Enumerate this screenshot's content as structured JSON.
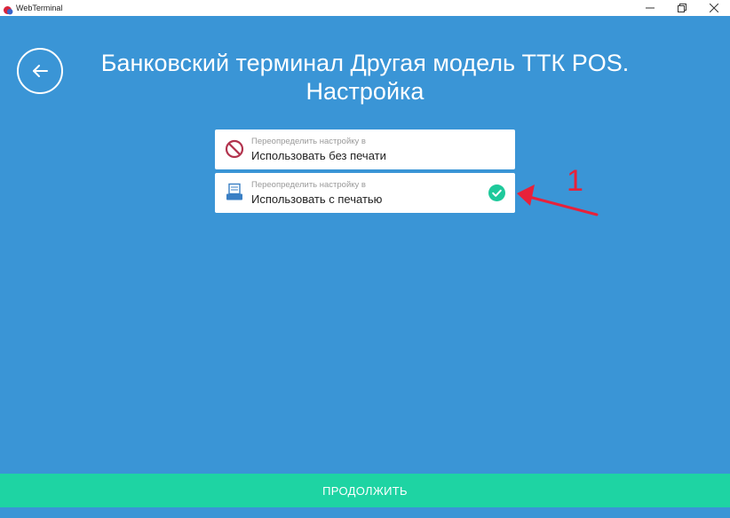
{
  "window": {
    "title": "WebTerminal",
    "controls": [
      "minimize-icon",
      "restore-icon",
      "close-icon"
    ]
  },
  "header": {
    "back_icon": "arrow-left-icon",
    "title": "Банковский терминал Другая модель ТТК POS. Настройка"
  },
  "options": [
    {
      "icon": "no-print-icon",
      "hint": "Переопределить настройку в",
      "value": "Использовать без печати",
      "selected": false
    },
    {
      "icon": "printer-icon",
      "hint": "Переопределить настройку в",
      "value": "Использовать с печатью",
      "selected": true
    }
  ],
  "annotation": {
    "label": "1",
    "color": "#e8213a"
  },
  "footer": {
    "continue_label": "ПРОДОЛЖИТЬ"
  },
  "colors": {
    "background": "#3a95d6",
    "accent": "#1ed4a3",
    "selected_check": "#1ec99b",
    "no_print": "#b2334d",
    "printer": "#3a7fc4"
  }
}
